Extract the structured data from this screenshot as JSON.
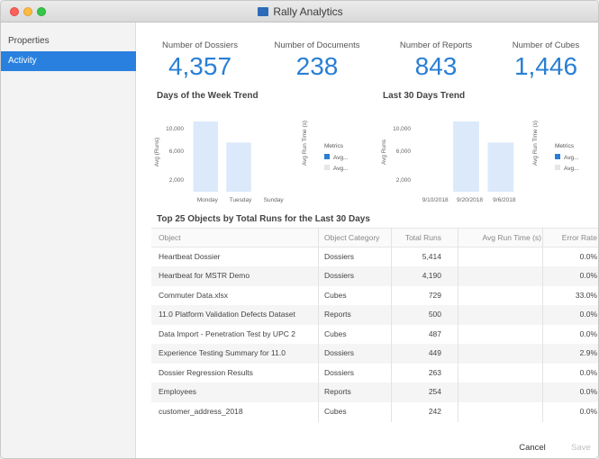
{
  "window": {
    "title": "Rally Analytics"
  },
  "sidebar": {
    "items": [
      {
        "label": "Properties",
        "active": false
      },
      {
        "label": "Activity",
        "active": true
      }
    ]
  },
  "stats": [
    {
      "label": "Number of Dossiers",
      "value": "4,357"
    },
    {
      "label": "Number of Documents",
      "value": "238"
    },
    {
      "label": "Number of Reports",
      "value": "843"
    },
    {
      "label": "Number of Cubes",
      "value": "1,446"
    }
  ],
  "charts": {
    "week": {
      "title": "Days of the Week Trend"
    },
    "month": {
      "title": "Last 30 Days Trend"
    }
  },
  "chart_data": [
    {
      "type": "bar",
      "title": "Days of the Week Trend",
      "categories": [
        "Monday",
        "Tuesday",
        "Sunday"
      ],
      "series": [
        {
          "name": "Avg...",
          "values": [
            10000,
            7000,
            0
          ]
        }
      ],
      "yticks": [
        "10,000",
        "6,000",
        "2,000"
      ],
      "ylim": [
        0,
        10500
      ],
      "ylabel": "Avg (Runs)",
      "y2label": "Avg Run Time (s)",
      "legend_title": "Metrics",
      "legend": [
        "Avg...",
        "Avg..."
      ],
      "legend_colors": [
        "#2a7fd4",
        "#e6e6e6"
      ],
      "bar_color": "#dbe9fb"
    },
    {
      "type": "bar",
      "title": "Last 30 Days Trend",
      "categories": [
        "9/10/2018",
        "9/20/2018",
        "9/6/2018"
      ],
      "series": [
        {
          "name": "Avg...",
          "values": [
            0,
            10000,
            7000
          ]
        }
      ],
      "yticks": [
        "10,000",
        "6,000",
        "2,000"
      ],
      "ylim": [
        0,
        10500
      ],
      "ylabel": "Avg Runs",
      "y2label": "Avg Run Time (s)",
      "legend_title": "Metrics",
      "legend": [
        "Avg...",
        "Avg..."
      ],
      "legend_colors": [
        "#2a7fd4",
        "#e6e6e6"
      ],
      "bar_color": "#dbe9fb"
    }
  ],
  "table": {
    "title": "Top 25 Objects by Total Runs for the Last 30 Days",
    "headers": [
      "Object",
      "Object Category",
      "Total Runs",
      "Avg Run Time (s)",
      "Error Rate"
    ],
    "rows": [
      [
        "Heartbeat Dossier",
        "Dossiers",
        "5,414",
        "",
        "0.0%"
      ],
      [
        "Heartbeat for MSTR Demo",
        "Dossiers",
        "4,190",
        "",
        "0.0%"
      ],
      [
        "Commuter Data.xlsx",
        "Cubes",
        "729",
        "",
        "33.0%"
      ],
      [
        "11.0 Platform Validation Defects Dataset",
        "Reports",
        "500",
        "",
        "0.0%"
      ],
      [
        "Data Import - Penetration Test by UPC 2",
        "Cubes",
        "487",
        "",
        "0.0%"
      ],
      [
        "Experience Testing Summary for 11.0",
        "Dossiers",
        "449",
        "",
        "2.9%"
      ],
      [
        "Dossier Regression Results",
        "Dossiers",
        "263",
        "",
        "0.0%"
      ],
      [
        "Employees",
        "Reports",
        "254",
        "",
        "0.0%"
      ],
      [
        "customer_address_2018",
        "Cubes",
        "242",
        "",
        "0.0%"
      ]
    ]
  },
  "buttons": {
    "cancel": "Cancel",
    "save": "Save"
  }
}
